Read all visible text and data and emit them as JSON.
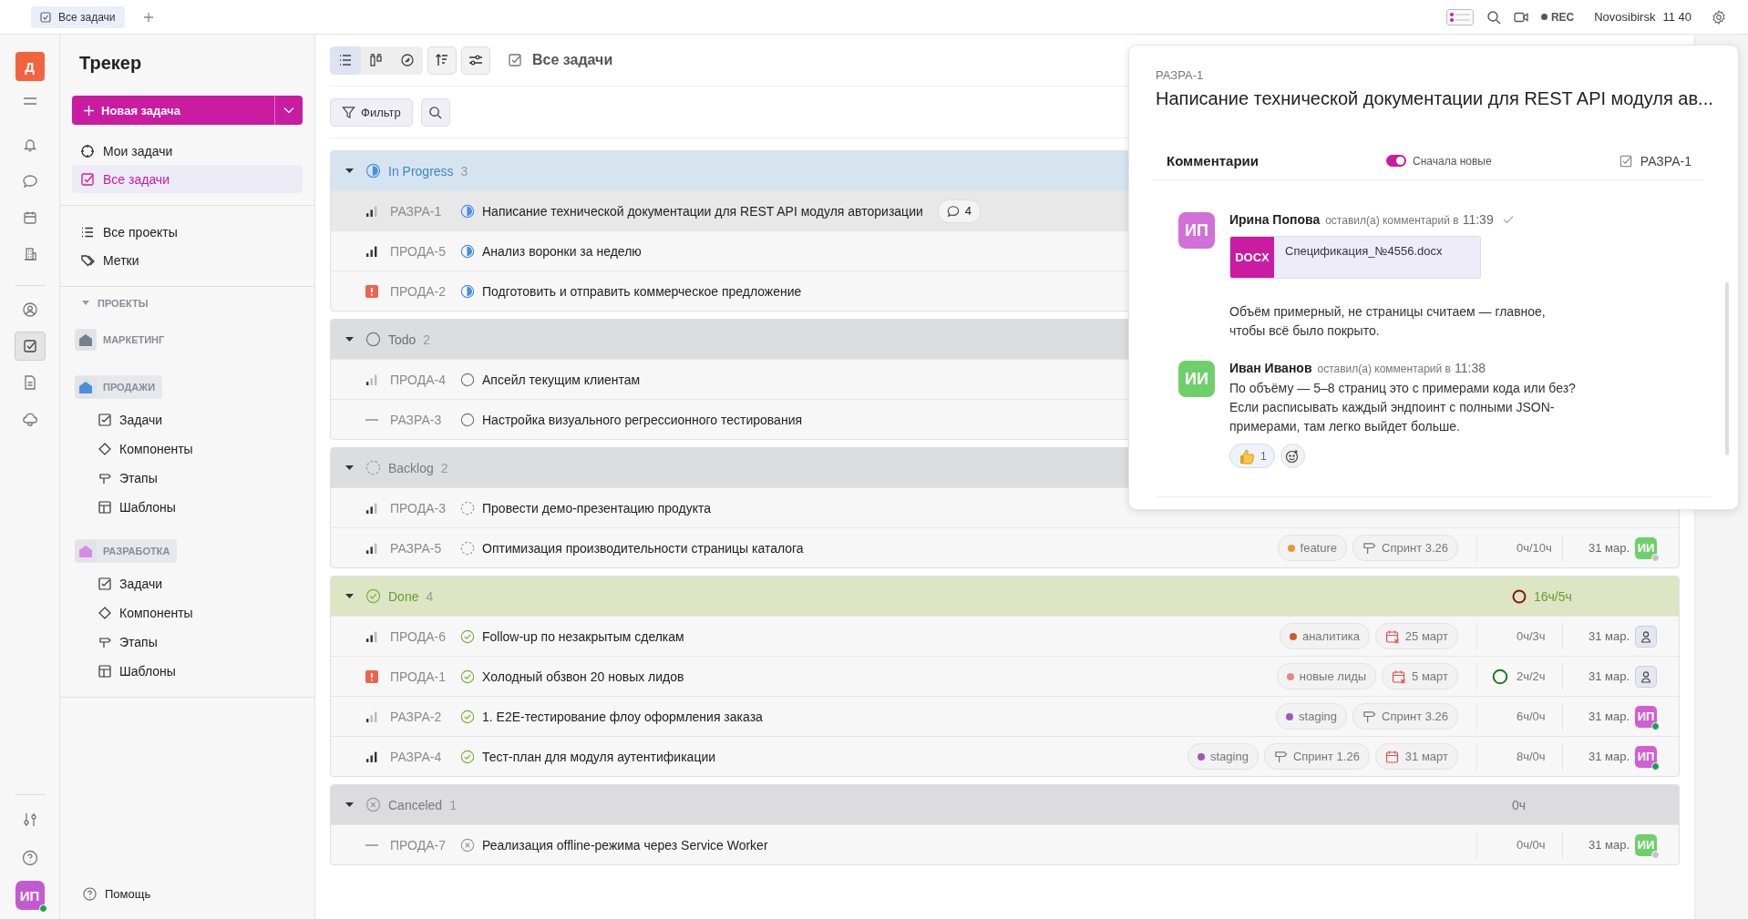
{
  "browser_tabs": [
    {
      "label": "Все задачи",
      "selected": true
    }
  ],
  "top_bar": {
    "rec": "REC",
    "city": "Novosibirsk",
    "time": "11 40"
  },
  "rail": {
    "logo": "Д",
    "items": [
      {
        "kind": "bell",
        "selected": false
      },
      {
        "kind": "chat",
        "selected": false
      },
      {
        "kind": "calendar",
        "selected": false
      },
      {
        "kind": "building",
        "selected": false
      }
    ],
    "items2": [
      {
        "kind": "user",
        "selected": false
      },
      {
        "kind": "tasks",
        "selected": true
      },
      {
        "kind": "doc",
        "selected": false
      },
      {
        "kind": "cloud",
        "selected": false
      }
    ],
    "user": {
      "initials": "ИП",
      "online": true
    }
  },
  "sidebar": {
    "title": "Трекер",
    "new_button": "Новая задача",
    "nav": [
      {
        "label": "Мои задачи",
        "kind": "target",
        "selected": false
      },
      {
        "label": "Все задачи",
        "kind": "check",
        "selected": true
      }
    ],
    "nav2": [
      {
        "label": "Все проекты",
        "kind": "list",
        "selected": false
      },
      {
        "label": "Метки",
        "kind": "tag",
        "selected": false
      }
    ],
    "projects_header": {
      "label": "ПРОЕКТЫ",
      "expanded": true
    },
    "projects": [
      {
        "name": "МАРКЕТИНГ",
        "color": "#76808c",
        "expanded": false
      },
      {
        "name": "ПРОДАЖИ",
        "color": "#4a90d9",
        "expanded": true,
        "children": [
          {
            "label": "Задачи",
            "kind": "check"
          },
          {
            "label": "Компоненты",
            "kind": "diamond"
          },
          {
            "label": "Этапы",
            "kind": "sign"
          },
          {
            "label": "Шаблоны",
            "kind": "template"
          }
        ]
      },
      {
        "name": "РАЗРАБОТКА",
        "color": "#d58ae8",
        "expanded": true,
        "children": [
          {
            "label": "Задачи",
            "kind": "check"
          },
          {
            "label": "Компоненты",
            "kind": "diamond"
          },
          {
            "label": "Этапы",
            "kind": "sign"
          },
          {
            "label": "Шаблоны",
            "kind": "template"
          }
        ]
      }
    ],
    "help": "Помощь"
  },
  "toolbar": {
    "views": [
      {
        "kind": "list",
        "selected": true
      },
      {
        "kind": "board",
        "selected": false
      },
      {
        "kind": "timeline",
        "selected": false
      }
    ],
    "title": "Все задачи",
    "filter": "Фильтр"
  },
  "groups": [
    {
      "name": "In Progress",
      "kind": "in_progress",
      "count": "3",
      "expanded": true,
      "rows": [
        {
          "kind": "medium",
          "key": "РАЗРА-1",
          "title": "Написание технической документации для REST API модуля авторизации",
          "comments": "4",
          "selected": true
        },
        {
          "kind": "high",
          "key": "ПРОДА-5",
          "title": "Анализ воронки за неделю",
          "selected": false
        },
        {
          "kind": "urgent",
          "key": "ПРОДА-2",
          "title": "Подготовить и отправить коммерческое предложение",
          "selected": false
        }
      ]
    },
    {
      "name": "Todo",
      "kind": "todo",
      "count": "2",
      "expanded": true,
      "rows": [
        {
          "kind": "low",
          "key": "ПРОДА-4",
          "title": "Апсейл текущим клиентам",
          "selected": false
        },
        {
          "kind": "none",
          "key": "РАЗРА-3",
          "title": "Настройка визуального регрессионного тестирования",
          "selected": false
        }
      ]
    },
    {
      "name": "Backlog",
      "kind": "backlog",
      "count": "2",
      "expanded": true,
      "rows": [
        {
          "kind": "medium",
          "key": "ПРОДА-3",
          "title": "Провести демо-презентацию продукта",
          "selected": false
        },
        {
          "kind": "medium",
          "key": "РАЗРА-5",
          "title": "Оптимизация производительности страницы каталога",
          "selected": false,
          "tags": [
            {
              "kind": "label",
              "text": "feature",
              "color": "#e09a3a"
            },
            {
              "kind": "sprint",
              "text": "Спринт 3.26"
            }
          ],
          "time": "0ч/10ч",
          "date": "31 мар.",
          "assignee": {
            "kind": "user",
            "initials": "ИИ",
            "color": "#6fcf6a",
            "online": false
          }
        }
      ]
    },
    {
      "name": "Done",
      "kind": "done",
      "count": "4",
      "expanded": true,
      "time": "16ч/5ч",
      "ring": {
        "color": "#8b1010"
      },
      "rows": [
        {
          "kind": "medium",
          "key": "ПРОДА-6",
          "title": "Follow-up по незакрытым сделкам",
          "selected": false,
          "tags": [
            {
              "kind": "label",
              "text": "аналитика",
              "color": "#c8602a"
            },
            {
              "kind": "overdue",
              "text": "25 март"
            }
          ],
          "time": "0ч/3ч",
          "date": "31 мар.",
          "assignee": {
            "kind": "none"
          }
        },
        {
          "kind": "urgent",
          "key": "ПРОДА-1",
          "title": "Холодный обзвон 20 новых лидов",
          "selected": false,
          "tags": [
            {
              "kind": "label",
              "text": "новые лиды",
              "color": "#e08a80"
            },
            {
              "kind": "overdue",
              "text": "5 март"
            }
          ],
          "time": "2ч/2ч",
          "ring": {
            "color": "#1a7a1a"
          },
          "date": "31 мар.",
          "assignee": {
            "kind": "none"
          }
        },
        {
          "kind": "low",
          "key": "РАЗРА-2",
          "title": "1. E2E-тестирование флоу оформления заказа",
          "selected": false,
          "tags": [
            {
              "kind": "label",
              "text": "staging",
              "color": "#9b59c0"
            },
            {
              "kind": "sprint",
              "text": "Спринт 3.26"
            }
          ],
          "time": "6ч/0ч",
          "date": "31 мар.",
          "assignee": {
            "kind": "user",
            "initials": "ИП",
            "color": "#d060d0",
            "online": true
          }
        },
        {
          "kind": "high",
          "key": "РАЗРА-4",
          "title": "Тест-план для модуля аутентификации",
          "selected": false,
          "tags": [
            {
              "kind": "label",
              "text": "staging",
              "color": "#9b59c0"
            },
            {
              "kind": "sprint",
              "text": "Спринт 1.26"
            },
            {
              "kind": "due",
              "text": "31 март"
            }
          ],
          "time": "8ч/0ч",
          "date": "31 мар.",
          "assignee": {
            "kind": "user",
            "initials": "ИП",
            "color": "#d060d0",
            "online": true
          }
        }
      ]
    },
    {
      "name": "Canceled",
      "kind": "canceled",
      "count": "1",
      "expanded": true,
      "time": "0ч",
      "rows": [
        {
          "kind": "none",
          "key": "ПРОДА-7",
          "title": "Реализация offline-режима через Service Worker",
          "selected": false,
          "time": "0ч/0ч",
          "date": "31 мар.",
          "assignee": {
            "kind": "user",
            "initials": "ИИ",
            "color": "#6fcf6a",
            "online": false
          }
        }
      ]
    }
  ],
  "panel": {
    "key": "РАЗРА-1",
    "title": "Написание технической документации для REST API модуля ав...",
    "section": "Комментарии",
    "toggle": {
      "label": "Сначала новые",
      "on": true
    },
    "ref": "РАЗРА-1",
    "comments": [
      {
        "initials": "ИП",
        "color": "#d070d8",
        "author": "Ирина Попова",
        "meta": "оставил(а) комментарий в",
        "time": "11:39",
        "read": true,
        "attachment": {
          "type": "DOCX",
          "name": "Спецификация_№4556.docx"
        },
        "text": "Объём примерный, не страницы считаем — главное, чтобы всё было покрыто."
      },
      {
        "initials": "ИИ",
        "color": "#6fcf6a",
        "author": "Иван Иванов",
        "meta": "оставил(а) комментарий в",
        "time": "11:38",
        "read": false,
        "text": "По объёму — 5–8 страниц это с примерами кода или без? Если расписывать каждый эндпоинт с полными JSON-примерами, там легко выйдет больше.",
        "reactions": [
          {
            "kind": "thumbs_up",
            "count": "1"
          }
        ]
      }
    ]
  }
}
